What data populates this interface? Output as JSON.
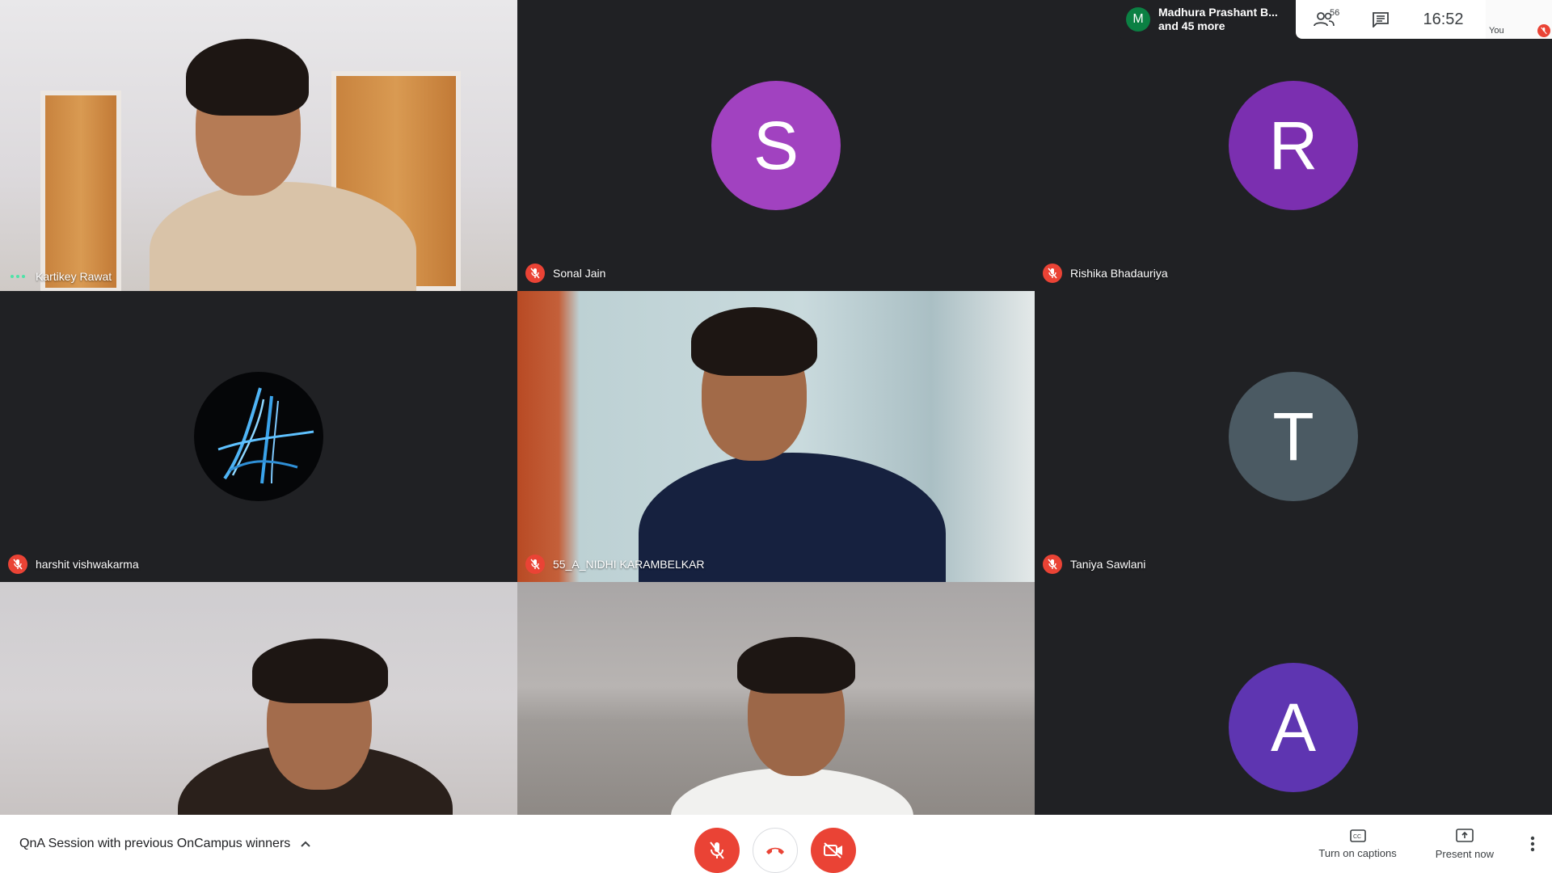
{
  "meeting": {
    "title": "QnA Session with previous OnCampus winners",
    "time": "16:52",
    "people_count": "56"
  },
  "presenter": {
    "initial": "M",
    "line1": "Madhura Prashant B...",
    "line2": "and 45 more"
  },
  "self_view": {
    "label": "You"
  },
  "tiles": [
    {
      "name": "Kartikey Rawat",
      "state": "speaking",
      "type": "video"
    },
    {
      "name": "Sonal Jain",
      "state": "muted",
      "type": "initial",
      "initial": "S",
      "color": "#a142c0"
    },
    {
      "name": "Rishika Bhadauriya",
      "state": "muted",
      "type": "initial",
      "initial": "R",
      "color": "#7b2fb0"
    },
    {
      "name": "harshit vishwakarma",
      "state": "muted",
      "type": "logo"
    },
    {
      "name": "55_A_NIDHI KARAMBELKAR",
      "state": "muted",
      "type": "video"
    },
    {
      "name": "Taniya Sawlani",
      "state": "muted",
      "type": "initial",
      "initial": "T",
      "color": "#4b5a63"
    },
    {
      "name": "",
      "state": "none",
      "type": "video"
    },
    {
      "name": "",
      "state": "none",
      "type": "video"
    },
    {
      "name": "",
      "state": "none",
      "type": "initial",
      "initial": "A",
      "color": "#5e35b1"
    }
  ],
  "actions": {
    "captions_label": "Turn on captions",
    "present_label": "Present now"
  },
  "icons": {
    "mic": "mic-off-icon",
    "hangup": "phone-hangup-icon",
    "camera": "videocam-off-icon",
    "captions": "closed-captions-icon",
    "present": "present-screen-icon",
    "people": "people-icon",
    "chat": "chat-icon",
    "more": "more-vert-icon",
    "chevron": "chevron-up-icon"
  },
  "colors": {
    "accent_red": "#ea4335",
    "background": "#202124",
    "toolbar": "#ffffff"
  }
}
